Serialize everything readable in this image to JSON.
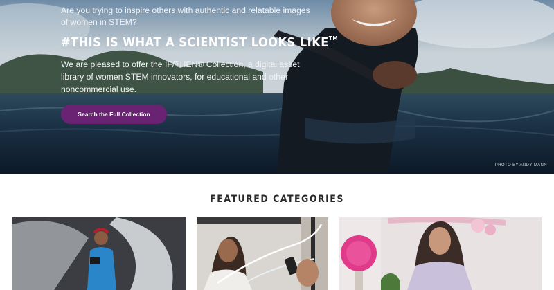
{
  "hero": {
    "intro": "Are you trying to inspire others with authentic and relatable images of women in STEM?",
    "hashtag": "#THIS IS WHAT A SCIENTIST LOOKS LIKE",
    "trademark": "TM",
    "offer": "We are pleased to offer the IF/THEN® Collection, a digital asset library of women STEM innovators, for educational and other noncommercial use.",
    "button_label": "Search the Full Collection",
    "photo_credit": "PHOTO BY ANDY MANN"
  },
  "featured": {
    "title": "FEATURED CATEGORIES",
    "cards": [
      {
        "name": "category-card-1"
      },
      {
        "name": "category-card-2"
      },
      {
        "name": "category-card-3"
      }
    ]
  },
  "colors": {
    "button": "#6a2373",
    "heading": "#2a2a2a"
  }
}
